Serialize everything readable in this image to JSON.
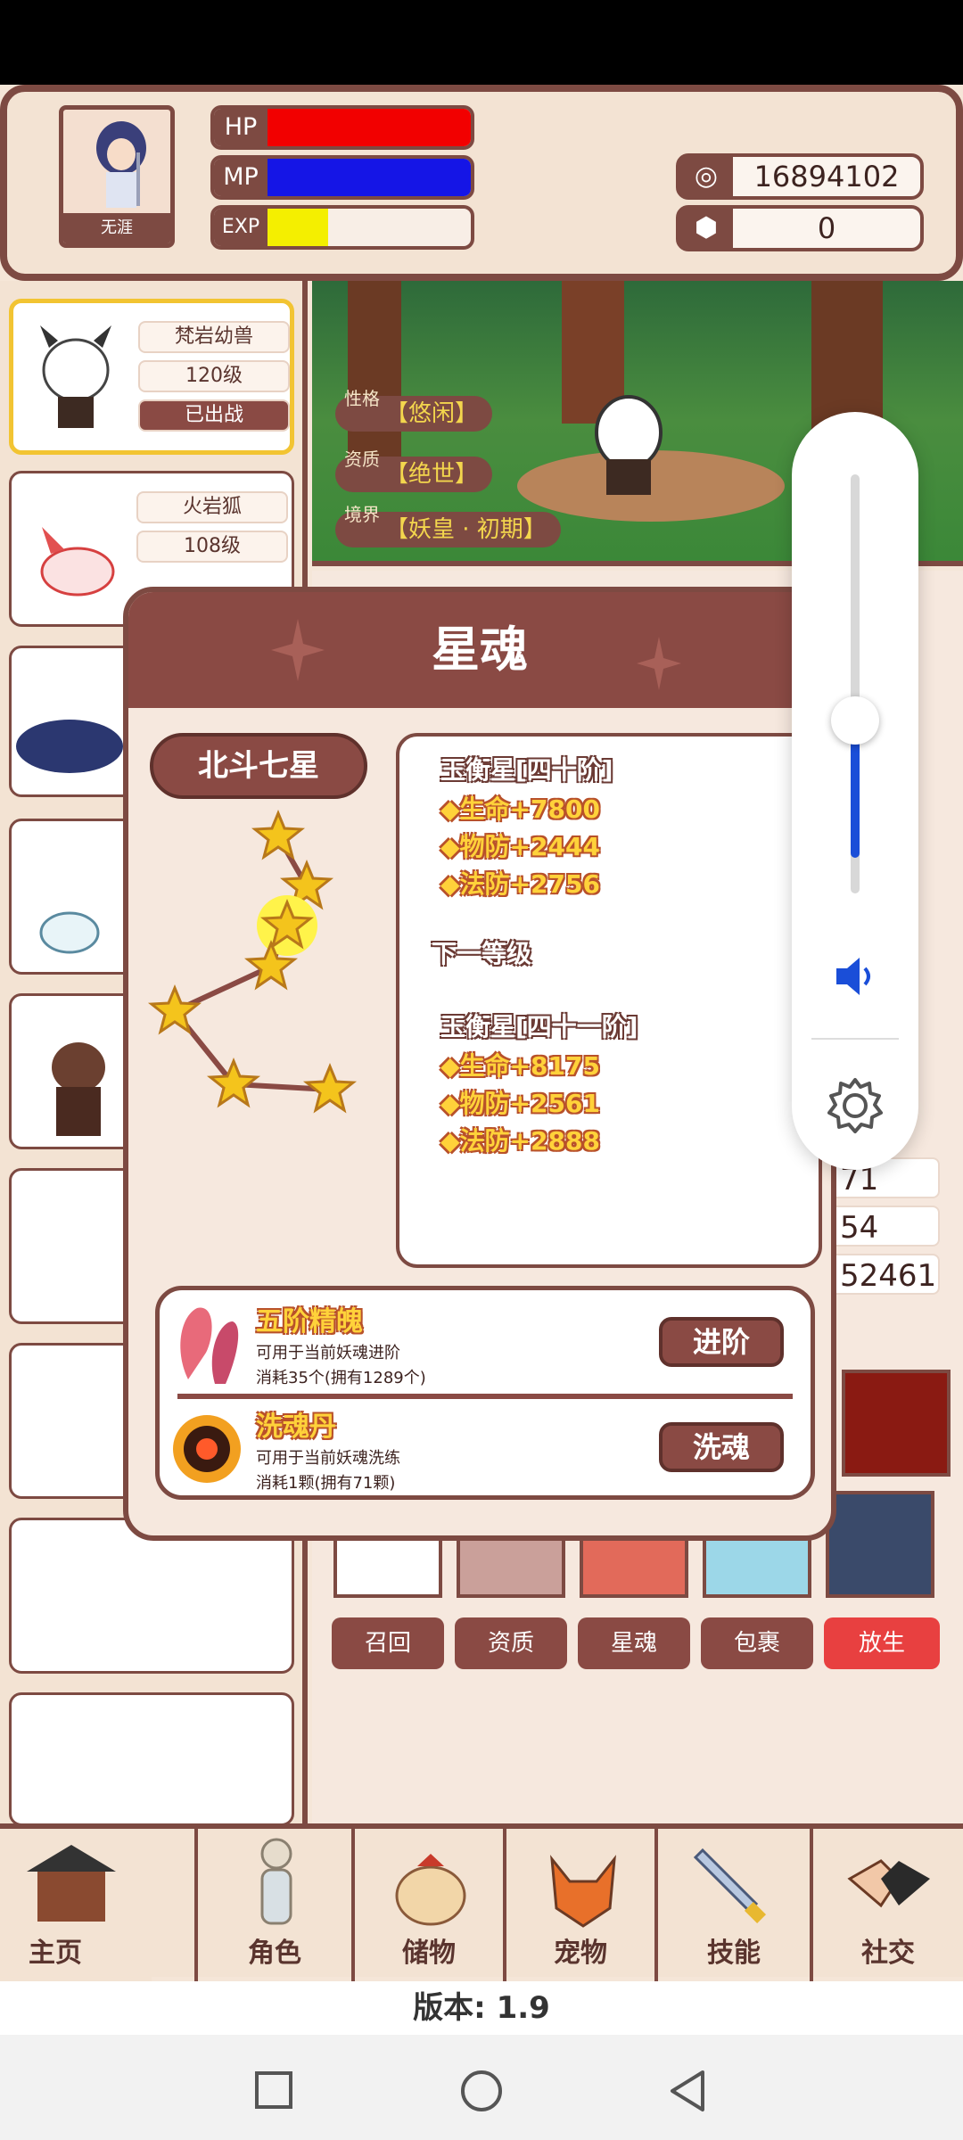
{
  "player": {
    "name": "无涯",
    "hp_label": "HP",
    "mp_label": "MP",
    "exp_label": "EXP",
    "exp_level": 0.3
  },
  "currency": {
    "gold": "16894102",
    "gems": "0"
  },
  "pets": [
    {
      "name": "梵岩幼兽",
      "level": "120级",
      "status": "已出战"
    },
    {
      "name": "火岩狐",
      "level": "108级"
    }
  ],
  "scene": {
    "traits": [
      {
        "key": "性格",
        "value": "【悠闲】"
      },
      {
        "key": "资质",
        "value": "【绝世】"
      },
      {
        "key": "境界",
        "value": "【妖皇 · 初期】"
      }
    ]
  },
  "modal": {
    "title": "星魂",
    "constellation": "北斗七星",
    "current_header": "玉衡星[四十阶]",
    "current_stats": [
      "◆生命+7800",
      "◆物防+2444",
      "◆法防+2756"
    ],
    "next_label": "下一等级",
    "next_header": "玉衡星[四十一阶]",
    "next_stats": [
      "◆生命+8175",
      "◆物防+2561",
      "◆法防+2888"
    ],
    "items": [
      {
        "name": "五阶精魄",
        "desc": "可用于当前妖魂进阶",
        "cost": "消耗35个(拥有1289个)",
        "button": "进阶"
      },
      {
        "name": "洗魂丹",
        "desc": "可用于当前妖魂洗练",
        "cost": "消耗1颗(拥有71颗)",
        "button": "洗魂"
      }
    ]
  },
  "stats_partial": [
    "71",
    "54",
    "52461"
  ],
  "actions": [
    "召回",
    "资质",
    "星魂",
    "包裹",
    "放生"
  ],
  "nav": [
    "主页",
    "角色",
    "储物",
    "宠物",
    "技能",
    "社交"
  ],
  "version": "版本: 1.9",
  "volume": {
    "level": 0.4
  }
}
